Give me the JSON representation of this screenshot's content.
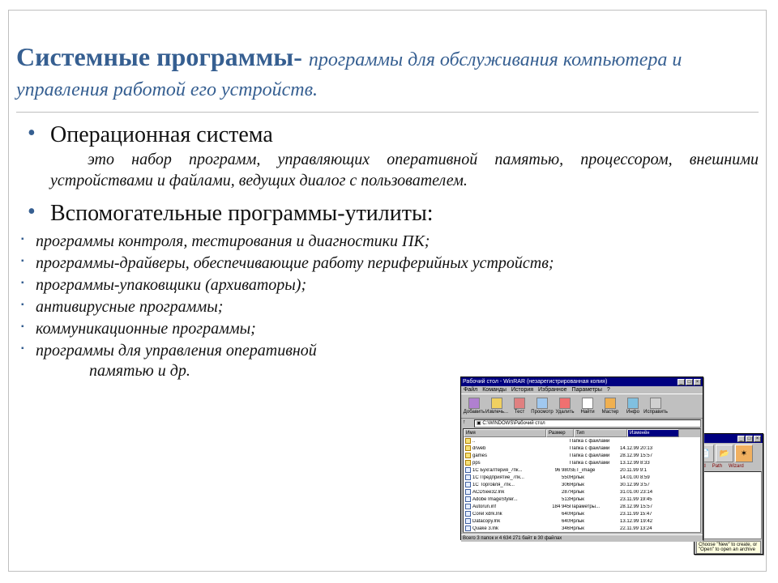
{
  "title": {
    "bold": "Системные программы- ",
    "italic": "программы для обслуживания компьютера и управления работой его устройств."
  },
  "bullet1": {
    "heading": "Операционная система"
  },
  "desc1": "это набор программ, управляющих оперативной памятью, процессором, внешними устройствами и файлами, ведущих диалог с пользователем.",
  "bullet2": {
    "heading": "Вспомогательные программы-утилиты:"
  },
  "sub": {
    "i0": "программы контроля, тестирования и диагностики ПК;",
    "i1": "программы-драйверы, обеспечивающие работу периферийных устройств;",
    "i2": "программы-упаковщики (архиваторы);",
    "i3": "антивирусные программы;",
    "i4": "коммуникационные программы;",
    "i5": "программы для управления оперативной",
    "i5b": "памятью и др."
  },
  "win1": {
    "title": "Рабочий стол - WinRAR (незарегистрированная копия)",
    "menu": {
      "m0": "Файл",
      "m1": "Команды",
      "m2": "История",
      "m3": "Избранное",
      "m4": "Параметры",
      "m5": "?"
    },
    "tb": {
      "b0": "Добавить",
      "b1": "Извлечь...",
      "b2": "Тест",
      "b3": "Просмотр",
      "b4": "Удалить",
      "b5": "Найти",
      "b6": "Мастер",
      "b7": "Инфо",
      "b8": "Исправить"
    },
    "addr_icon": "▣",
    "addr": "C:\\WINDOWS\\Рабочий стол",
    "cols": {
      "c0": "Имя",
      "c1": "Размер",
      "c2": "Тип",
      "c3": "Изменён"
    },
    "rows": [
      {
        "n": "..",
        "s": "",
        "t": "Папка с файлами",
        "d": ""
      },
      {
        "n": "drweb",
        "s": "",
        "t": "Папка с файлами",
        "d": "14.12.99 20:13"
      },
      {
        "n": "games",
        "s": "",
        "t": "Папка с файлами",
        "d": "28.12.99 15:57"
      },
      {
        "n": "pps",
        "s": "",
        "t": "Папка с файлами",
        "d": "13.12.99 8:33"
      },
      {
        "n": "1С Бухгалтерия_7пк...",
        "s": "96 980",
        "t": "SET_image",
        "d": "20.11.99 9:1"
      },
      {
        "n": "1С Предприятие_7пк...",
        "s": "550",
        "t": "Ярлык",
        "d": "14.01.00 8:59"
      },
      {
        "n": "1С Торговля_7пк...",
        "s": "306",
        "t": "Ярлык",
        "d": "30.12.99 3:57"
      },
      {
        "n": "ACDSee32.lnk",
        "s": "287",
        "t": "Ярлык",
        "d": "31.01.00 23:14"
      },
      {
        "n": "Adobe ImageStyler...",
        "s": "513",
        "t": "Ярлык",
        "d": "23.11.99 19:45"
      },
      {
        "n": "Autorun.inf",
        "s": "184 945",
        "t": "Параметры...",
        "d": "28.12.99 15:57"
      },
      {
        "n": "Corel xdrk.lnk",
        "s": "640",
        "t": "Ярлык",
        "d": "23.11.99 15:47"
      },
      {
        "n": "Datacopy.lnk",
        "s": "640",
        "t": "Ярлык",
        "d": "13.12.99 19:42"
      },
      {
        "n": "Quake 3.lnk",
        "s": "346",
        "t": "Ярлык",
        "d": "22.11.99 13:24"
      }
    ],
    "status": "Всего 3 папок и 4 634 271 байт в 30 файлах"
  },
  "win2": {
    "labels": {
      "l0": "Add",
      "l1": "Path",
      "l2": "",
      "l3": "Wizard"
    },
    "hint": "Choose \"New\" to create, or \"Open\" to open an archive"
  },
  "ctrl": {
    "min": "_",
    "max": "□",
    "close": "×"
  }
}
